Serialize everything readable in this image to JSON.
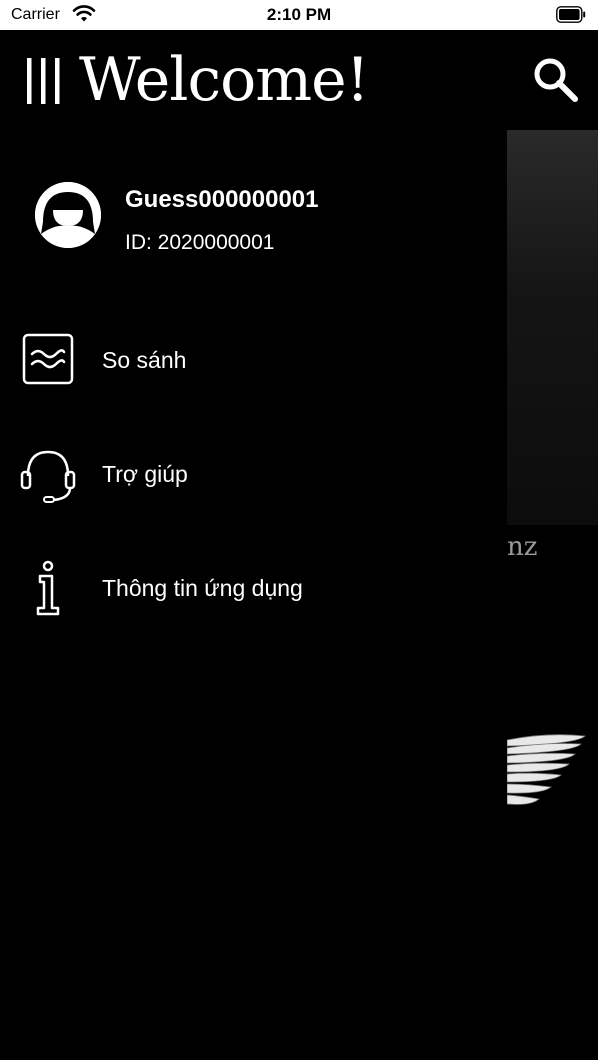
{
  "status_bar": {
    "carrier": "Carrier",
    "time": "2:10 PM"
  },
  "drawer": {
    "title": "Welcome!",
    "user": {
      "name": "Guess000000001",
      "id_text": "ID: 2020000001"
    },
    "items": [
      {
        "label": "So sánh",
        "icon": "compare-icon"
      },
      {
        "label": "Trợ giúp",
        "icon": "headset-icon"
      },
      {
        "label": "Thông tin ứng dụng",
        "icon": "info-icon"
      }
    ]
  },
  "background": {
    "brand_text_fragment": "nz"
  },
  "colors": {
    "background": "#000000",
    "text": "#ffffff",
    "status_bar": "#ffffff"
  }
}
